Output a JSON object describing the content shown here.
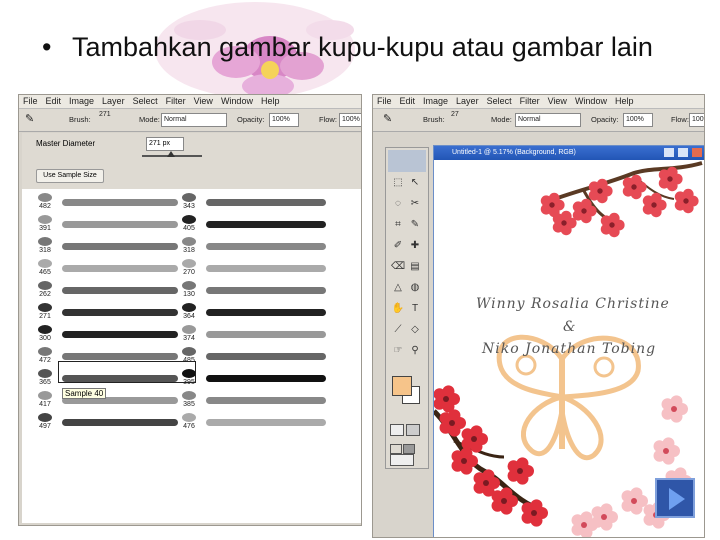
{
  "slide": {
    "bullet": "•",
    "title": "Tambahkan gambar kupu-kupu atau gambar lain"
  },
  "left_screenshot": {
    "menu": [
      "File",
      "Edit",
      "Image",
      "Layer",
      "Select",
      "Filter",
      "View",
      "Window",
      "Help"
    ],
    "options": {
      "brush_label": "Brush:",
      "brush_size": "271",
      "mode_label": "Mode:",
      "mode_value": "Normal",
      "opacity_label": "Opacity:",
      "opacity_value": "100%",
      "flow_label": "Flow:",
      "flow_value": "100%"
    },
    "panel": {
      "master_diameter_label": "Master Diameter",
      "master_diameter_value": "271 px",
      "sample_button": "Use Sample Size"
    },
    "brush_numbers_col1": [
      "482",
      "391",
      "318",
      "465",
      "262",
      "271",
      "300",
      "472",
      "365",
      "417",
      "497"
    ],
    "brush_numbers_col2": [
      "343",
      "405",
      "318",
      "270",
      "130",
      "364",
      "374",
      "485",
      "395",
      "385",
      "476"
    ],
    "tooltip": "Sample 40"
  },
  "right_screenshot": {
    "menu": [
      "File",
      "Edit",
      "Image",
      "Layer",
      "Select",
      "Filter",
      "View",
      "Window",
      "Help"
    ],
    "options": {
      "brush_label": "Brush:",
      "brush_size": "27",
      "mode_label": "Mode:",
      "mode_value": "Normal",
      "opacity_label": "Opacity:",
      "opacity_value": "100%",
      "flow_label": "Flow:",
      "flow_value": "100%"
    },
    "document_title": "Untitled-1 @ 5.17% (Background, RGB)",
    "canvas_text": {
      "line1": "Winny Rosalia Christine",
      "line2": "&",
      "line3": "Niko Jonathan Tobing"
    },
    "colors": {
      "foreground": "#f6c48a",
      "background": "#ffffff"
    }
  },
  "navigation": {
    "next_icon": "next-slide-icon",
    "accent": "#2f56a8"
  }
}
